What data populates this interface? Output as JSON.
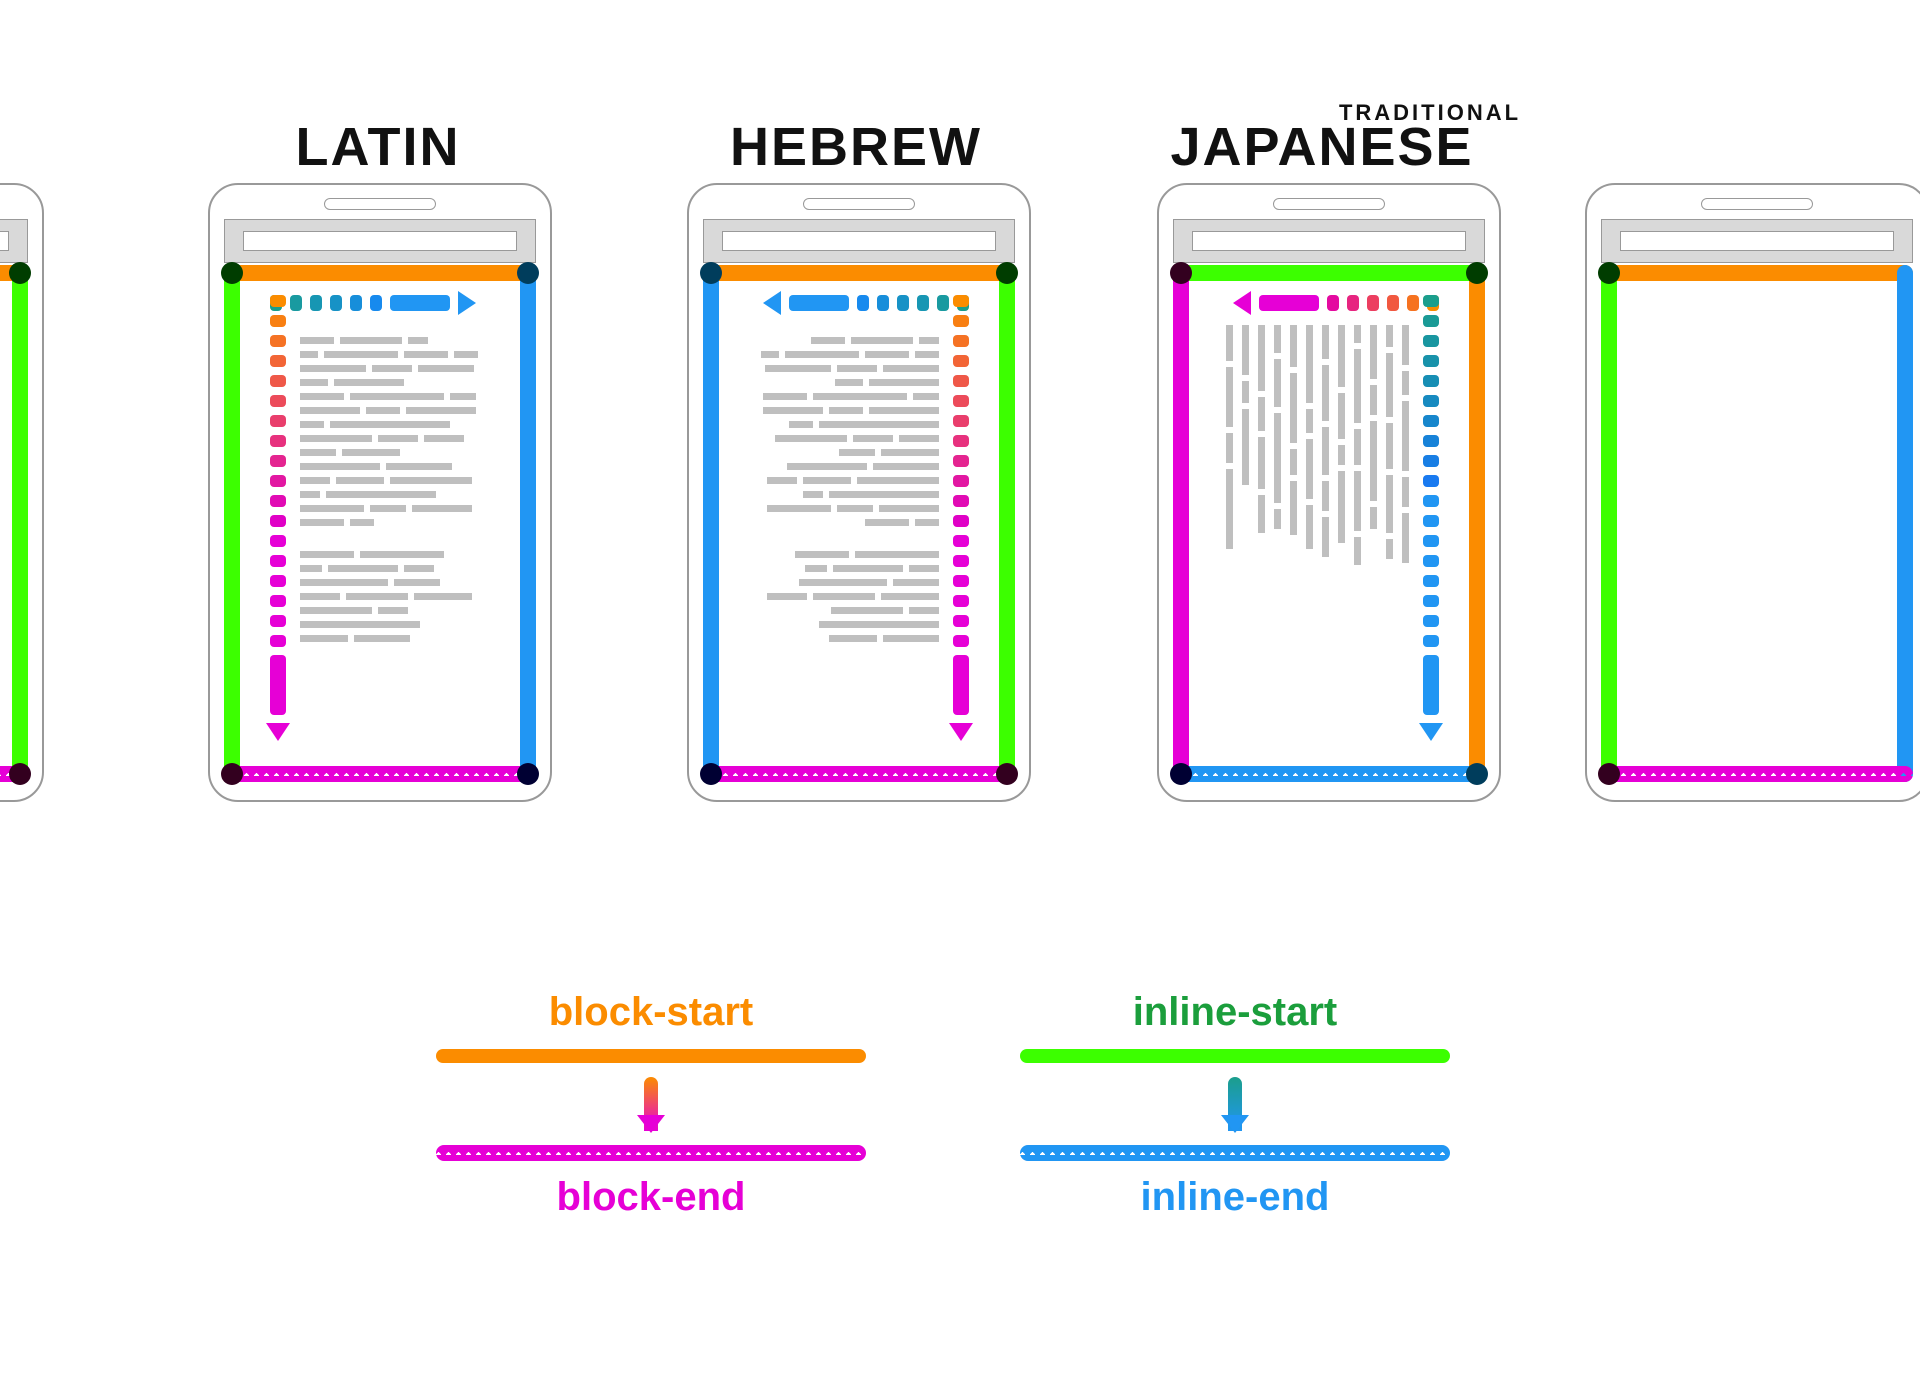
{
  "titles": {
    "latin": "LATIN",
    "hebrew": "HEBREW",
    "japanese": "JAPANESE",
    "japanese_sub": "TRADITIONAL"
  },
  "legend": {
    "block_start": "block-start",
    "block_end": "block-end",
    "inline_start": "inline-start",
    "inline_end": "inline-end"
  },
  "colors": {
    "block_start": "#fb8c00",
    "block_end": "#e600d6",
    "inline_start": "#3cff00",
    "inline_end": "#2196f3",
    "inline_start_label": "#1b9e3c"
  },
  "panels": [
    {
      "id": "latin",
      "inline_direction": "ltr",
      "block_direction": "ttb",
      "edges": {
        "top": "block-start",
        "bottom": "block-end",
        "left": "inline-start",
        "right": "inline-end"
      }
    },
    {
      "id": "hebrew",
      "inline_direction": "rtl",
      "block_direction": "ttb",
      "edges": {
        "top": "block-start",
        "bottom": "block-end",
        "left": "inline-end",
        "right": "inline-start"
      }
    },
    {
      "id": "japanese",
      "inline_direction": "ttb",
      "block_direction": "rtl",
      "edges": {
        "top": "inline-start",
        "bottom": "inline-end",
        "left": "block-end",
        "right": "block-start"
      }
    }
  ]
}
